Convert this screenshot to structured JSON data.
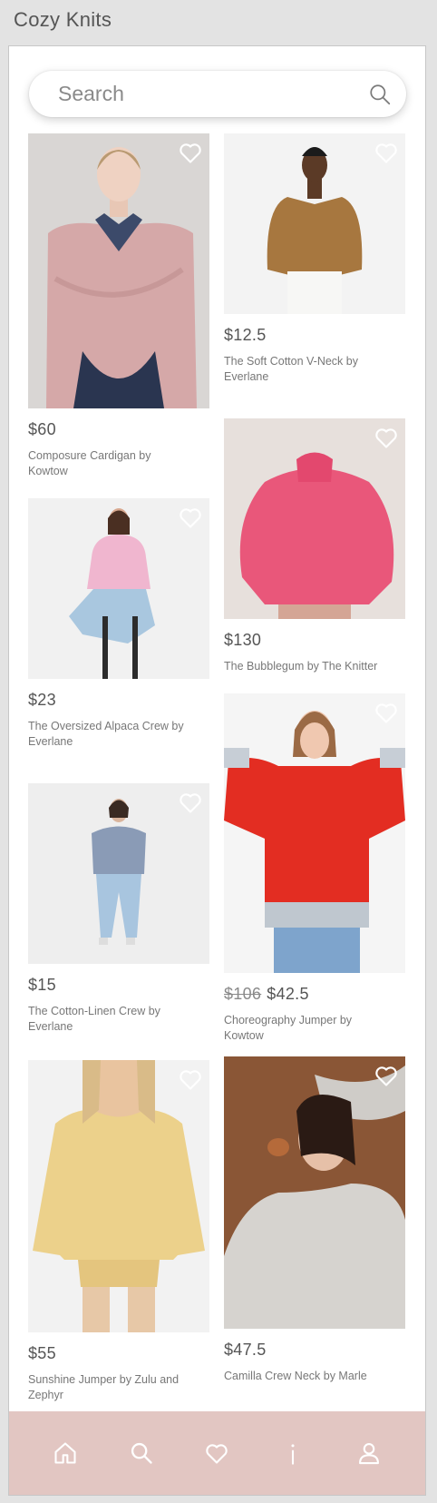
{
  "app": {
    "title": "Cozy Knits"
  },
  "search": {
    "placeholder": "Search"
  },
  "products": [
    {
      "price": "$60",
      "name": "Composure Cardigan by Kowtow",
      "image": "pink wrap cardigan over printed shirt"
    },
    {
      "price": "$12.5",
      "name": "The Soft Cotton V-Neck by Everlane",
      "image": "camel v-neck sweater"
    },
    {
      "price": "$130",
      "name": "The Bubblegum by The Knitter",
      "image": "pink chunky knit sweater"
    },
    {
      "price": "$23",
      "name": "The Oversized Alpaca Crew by Everlane",
      "image": "pink alpaca crew on stool"
    },
    {
      "price": "$42.5",
      "old_price": "$106",
      "name": "Choreography Jumper by Kowtow",
      "image": "red jumper with grey hem"
    },
    {
      "price": "$15",
      "name": "The Cotton-Linen Crew by Everlane",
      "image": "blue cotton-linen crew"
    },
    {
      "price": "$55",
      "name": "Sunshine Jumper by Zulu and Zephyr",
      "image": "yellow knit jumper and shorts"
    },
    {
      "price": "$47.5",
      "name": "Camilla Crew Neck by Marle",
      "image": "speckled grey crew neck"
    }
  ],
  "nav": [
    "home-icon",
    "search-icon",
    "heart-icon",
    "info-icon",
    "profile-icon"
  ],
  "colors": {
    "nav_background": "#e2c6c2",
    "page_background": "#e3e3e3",
    "text": "#555555"
  }
}
